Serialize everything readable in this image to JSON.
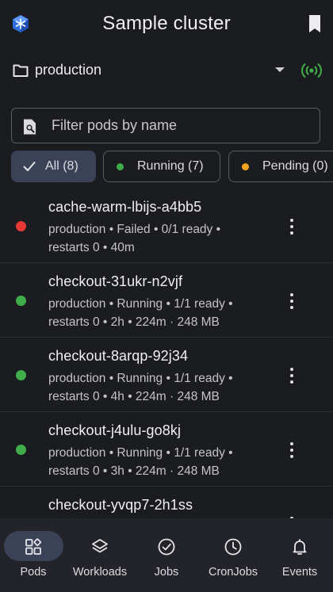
{
  "header": {
    "title": "Sample cluster",
    "logo_icon": "kubernetes-cube-icon",
    "bookmark_icon": "bookmark-icon"
  },
  "namespace": {
    "label": "production",
    "folder_icon": "folder-icon",
    "live_icon": "live-broadcast-icon",
    "live_color": "#3fae4a"
  },
  "search": {
    "placeholder": "Filter pods by name",
    "value": ""
  },
  "filters": [
    {
      "label": "All (8)",
      "selected": true,
      "icon": "check-icon"
    },
    {
      "label": "Running (7)",
      "selected": false,
      "dot_color": "#3fae4a"
    },
    {
      "label": "Pending (0)",
      "selected": false,
      "dot_color": "#f2a51a"
    }
  ],
  "pods": [
    {
      "name": "cache-warm-lbijs-a4bb5",
      "meta_line1": "production • Failed • 0/1 ready •",
      "meta_line2": "restarts 0 • 40m",
      "status": "failed",
      "status_color": "#e53935"
    },
    {
      "name": "checkout-31ukr-n2vjf",
      "meta_line1": "production • Running • 1/1 ready •",
      "meta_line2": "restarts 0 • 2h • 224m · 248 MB",
      "status": "running",
      "status_color": "#3fae4a"
    },
    {
      "name": "checkout-8arqp-92j34",
      "meta_line1": "production • Running • 1/1 ready •",
      "meta_line2": "restarts 0 • 4h • 224m · 248 MB",
      "status": "running",
      "status_color": "#3fae4a"
    },
    {
      "name": "checkout-j4ulu-go8kj",
      "meta_line1": "production • Running • 1/1 ready •",
      "meta_line2": "restarts 0 • 3h • 224m · 248 MB",
      "status": "running",
      "status_color": "#3fae4a"
    },
    {
      "name": "checkout-yvqp7-2h1ss",
      "meta_line1": "",
      "meta_line2": "",
      "status": "running",
      "status_color": "#3fae4a"
    }
  ],
  "bottom_nav": [
    {
      "label": "Pods",
      "icon": "pods-grid-icon",
      "active": true
    },
    {
      "label": "Workloads",
      "icon": "layers-icon",
      "active": false
    },
    {
      "label": "Jobs",
      "icon": "check-circle-icon",
      "active": false
    },
    {
      "label": "CronJobs",
      "icon": "clock-icon",
      "active": false
    },
    {
      "label": "Events",
      "icon": "bell-icon",
      "active": false
    }
  ],
  "colors": {
    "background": "#1b1c20",
    "nav_background": "#23242a",
    "selected_chip": "#3b4257",
    "accent_blue": "#3b82f6"
  }
}
